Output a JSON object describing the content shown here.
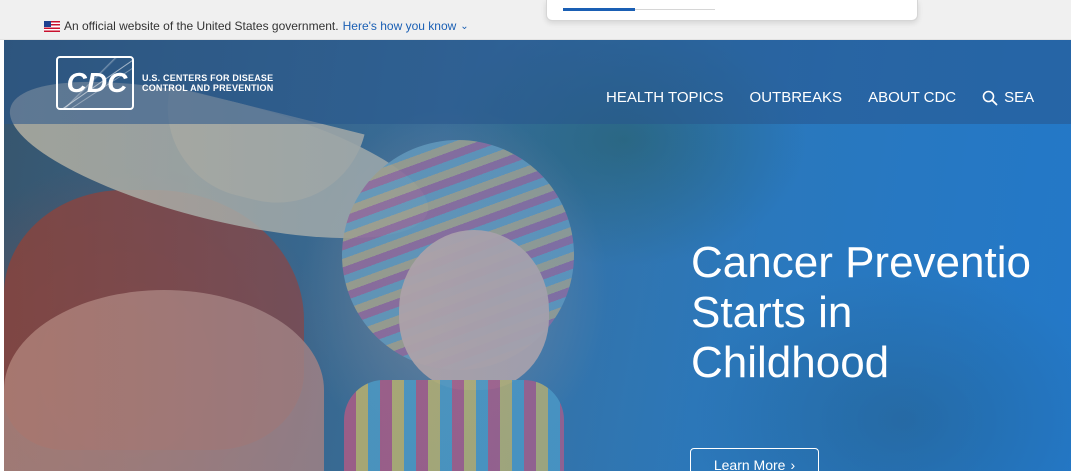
{
  "gov_banner": {
    "text": "An official website of the United States government.",
    "link": "Here's how you know",
    "chevron_icon": "chevron-down-icon"
  },
  "header": {
    "logo_mark": "CDC",
    "logo_line1": "U.S. CENTERS FOR DISEASE",
    "logo_line2": "CONTROL AND PREVENTION",
    "nav": [
      {
        "label": "HEALTH TOPICS"
      },
      {
        "label": "OUTBREAKS"
      },
      {
        "label": "ABOUT CDC"
      }
    ],
    "search_label": "SEA",
    "search_icon": "search-icon"
  },
  "hero": {
    "headline_line1": "Cancer Preventio",
    "headline_line2": "Starts in",
    "headline_line3": "Childhood",
    "cta_label": "Learn More",
    "cta_icon": "chevron-right-icon"
  },
  "colors": {
    "link": "#1a5fb4",
    "nav_text": "#ffffff",
    "hero_blue": "#2a86c8"
  }
}
